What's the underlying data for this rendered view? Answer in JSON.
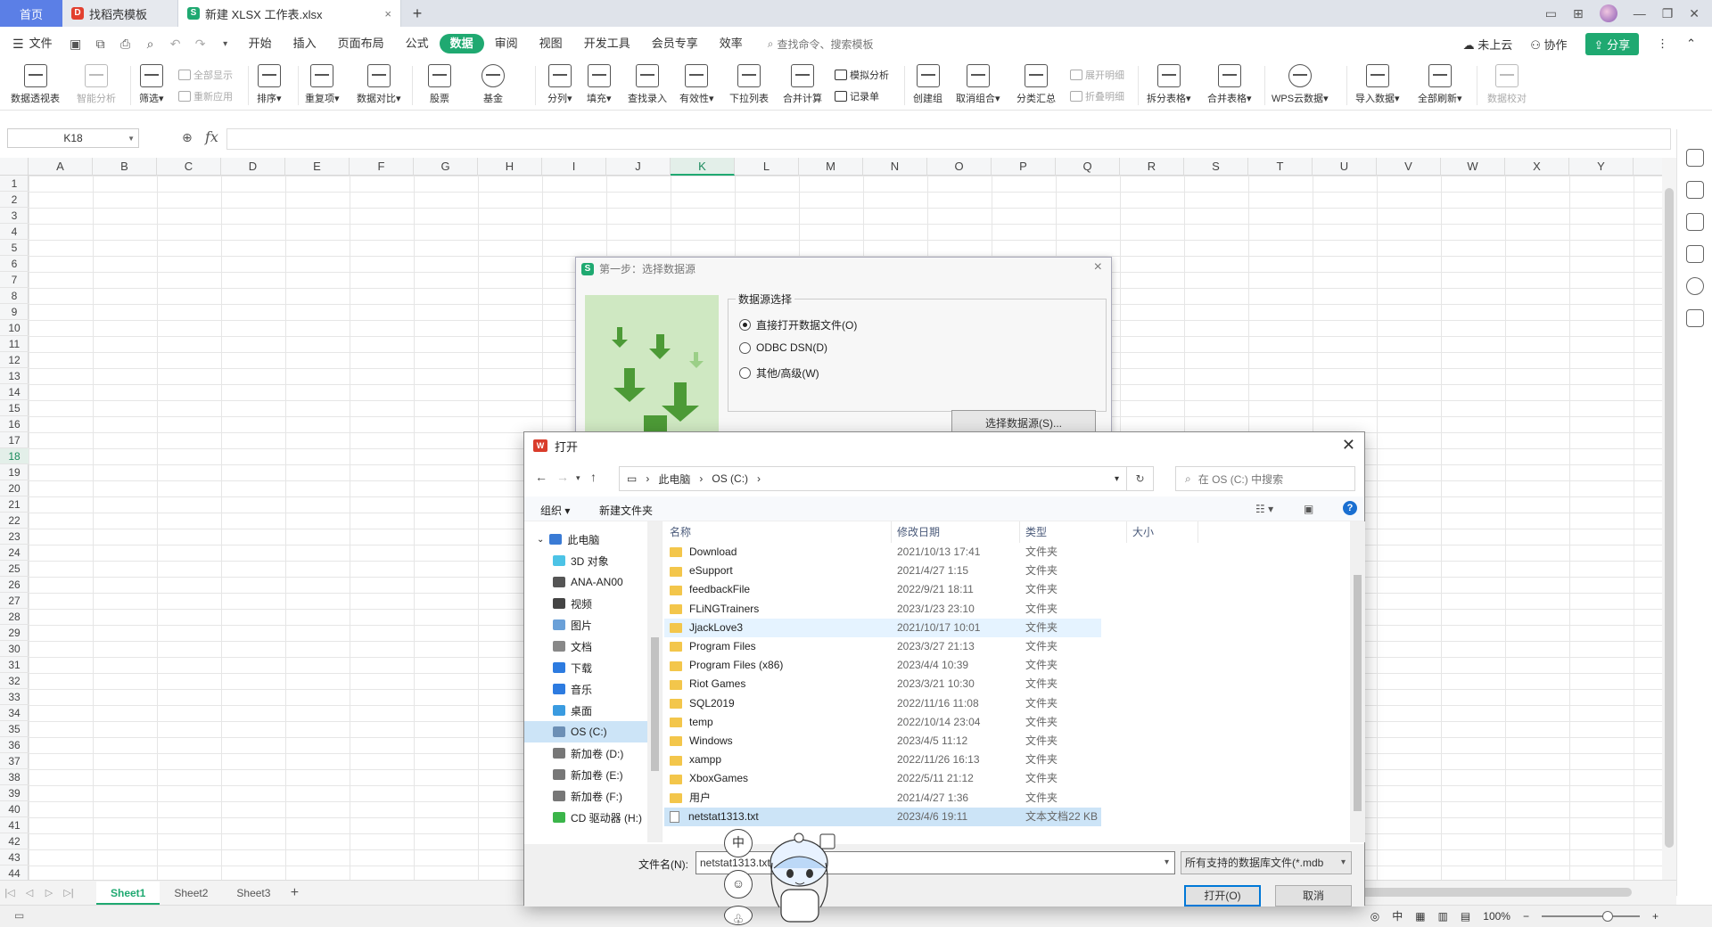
{
  "tabs": {
    "home": "首页",
    "template": "找稻壳模板",
    "file": "新建 XLSX 工作表.xlsx"
  },
  "menubar": {
    "file": "文件",
    "items": [
      "开始",
      "插入",
      "页面布局",
      "公式",
      "数据",
      "审阅",
      "视图",
      "开发工具",
      "会员专享",
      "效率"
    ],
    "active": "数据",
    "search_placeholder": "查找命令、搜索模板",
    "cloud": "未上云",
    "collab": "协作",
    "share": "分享"
  },
  "ribbon": {
    "pivot": "数据透视表",
    "smart": "智能分析",
    "filter": "筛选",
    "show_all": "全部显示",
    "reapply": "重新应用",
    "sort": "排序",
    "duplicate": "重复项",
    "compare": "数据对比",
    "stock": "股票",
    "fund": "基金",
    "split": "分列",
    "fill": "填充",
    "lookup": "查找录入",
    "validity": "有效性",
    "dropdown": "下拉列表",
    "consolidate": "合并计算",
    "simulate": "模拟分析",
    "record": "记录单",
    "group": "创建组",
    "ungroup": "取消组合",
    "subtotal": "分类汇总",
    "expand": "展开明细",
    "collapse": "折叠明细",
    "split_table": "拆分表格",
    "merge_table": "合并表格",
    "wps_cloud": "WPS云数据",
    "import": "导入数据",
    "refresh_all": "全部刷新",
    "verify": "数据校对"
  },
  "formula": {
    "cell": "K18",
    "fx": "fx",
    "value": ""
  },
  "grid": {
    "columns": [
      "A",
      "B",
      "C",
      "D",
      "E",
      "F",
      "G",
      "H",
      "I",
      "J",
      "K",
      "L",
      "M",
      "N",
      "O",
      "P",
      "Q",
      "R",
      "S",
      "T",
      "U",
      "V",
      "W",
      "X",
      "Y"
    ],
    "selected_col": "K",
    "selected_row": 18,
    "row_count": 44
  },
  "sheets": [
    "Sheet1",
    "Sheet2",
    "Sheet3"
  ],
  "active_sheet": "Sheet1",
  "status": {
    "zoom": "100%"
  },
  "dialog_source": {
    "title": "第一步：选择数据源",
    "group": "数据源选择",
    "options": [
      "直接打开数据文件(O)",
      "ODBC DSN(D)",
      "其他/高级(W)"
    ],
    "selected": 0,
    "choose_button": "选择数据源(S)..."
  },
  "dialog_open": {
    "title": "打开",
    "breadcrumb": [
      "此电脑",
      "OS (C:)"
    ],
    "search_placeholder": "在 OS (C:) 中搜索",
    "organize": "组织",
    "new_folder": "新建文件夹",
    "tree": [
      "此电脑",
      "3D 对象",
      "ANA-AN00",
      "视频",
      "图片",
      "文档",
      "下载",
      "音乐",
      "桌面",
      "OS (C:)",
      "新加卷 (D:)",
      "新加卷 (E:)",
      "新加卷 (F:)",
      "CD 驱动器 (H:)"
    ],
    "tree_selected": "OS (C:)",
    "columns": {
      "name": "名称",
      "date": "修改日期",
      "type": "类型",
      "size": "大小"
    },
    "files": [
      {
        "name": "Download",
        "date": "2021/10/13 17:41",
        "type": "文件夹",
        "size": "",
        "kind": "folder"
      },
      {
        "name": "eSupport",
        "date": "2021/4/27 1:15",
        "type": "文件夹",
        "size": "",
        "kind": "folder"
      },
      {
        "name": "feedbackFile",
        "date": "2022/9/21 18:11",
        "type": "文件夹",
        "size": "",
        "kind": "folder"
      },
      {
        "name": "FLiNGTrainers",
        "date": "2023/1/23 23:10",
        "type": "文件夹",
        "size": "",
        "kind": "folder"
      },
      {
        "name": "JjackLove3",
        "date": "2021/10/17 10:01",
        "type": "文件夹",
        "size": "",
        "kind": "folder"
      },
      {
        "name": "Program Files",
        "date": "2023/3/27 21:13",
        "type": "文件夹",
        "size": "",
        "kind": "folder"
      },
      {
        "name": "Program Files (x86)",
        "date": "2023/4/4 10:39",
        "type": "文件夹",
        "size": "",
        "kind": "folder"
      },
      {
        "name": "Riot Games",
        "date": "2023/3/21 10:30",
        "type": "文件夹",
        "size": "",
        "kind": "folder"
      },
      {
        "name": "SQL2019",
        "date": "2022/11/16 11:08",
        "type": "文件夹",
        "size": "",
        "kind": "folder"
      },
      {
        "name": "temp",
        "date": "2022/10/14 23:04",
        "type": "文件夹",
        "size": "",
        "kind": "folder"
      },
      {
        "name": "Windows",
        "date": "2023/4/5 11:12",
        "type": "文件夹",
        "size": "",
        "kind": "folder"
      },
      {
        "name": "xampp",
        "date": "2022/11/26 16:13",
        "type": "文件夹",
        "size": "",
        "kind": "folder"
      },
      {
        "name": "XboxGames",
        "date": "2022/5/11 21:12",
        "type": "文件夹",
        "size": "",
        "kind": "folder"
      },
      {
        "name": "用户",
        "date": "2021/4/27 1:36",
        "type": "文件夹",
        "size": "",
        "kind": "folder"
      },
      {
        "name": "netstat1313.txt",
        "date": "2023/4/6 19:11",
        "type": "文本文档",
        "size": "22 KB",
        "kind": "file"
      }
    ],
    "hover_index": 4,
    "selected_index": 14,
    "filename_label": "文件名(N):",
    "filename_value": "netstat1313.txt",
    "filetype": "所有支持的数据库文件(*.mdb",
    "open_button": "打开(O)",
    "cancel_button": "取消"
  },
  "mascot": {
    "bubble": "中"
  },
  "icons": {
    "back": "arrow-left-icon",
    "forward": "arrow-right-icon",
    "up": "arrow-up-icon",
    "refresh": "refresh-icon",
    "search": "search-icon",
    "close": "close-icon"
  },
  "colors": {
    "accent": "#1fa971",
    "home_tab": "#5b7fe6",
    "selection": "#cce4f7"
  }
}
